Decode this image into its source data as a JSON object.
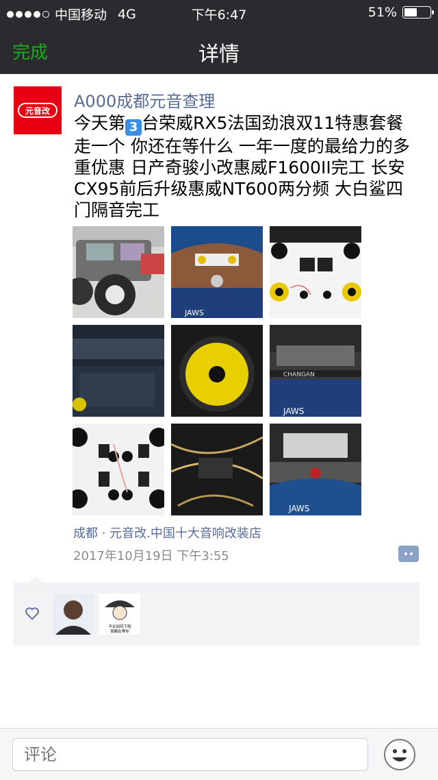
{
  "status_bar": {
    "carrier": "中国移动",
    "network": "4G",
    "time": "下午6:47",
    "battery": "51%",
    "battery_level": 0.51
  },
  "nav": {
    "done_label": "完成",
    "title": "详情"
  },
  "post": {
    "avatar_text": "元音改",
    "username": "A000成都元音查理",
    "text_before_badge": "今天第",
    "badge": "3",
    "text_after_badge": "台荣威RX5法国劲浪双11特惠套餐走一个 你还在等什么 一年一度的最给力的多重优惠 日产奇骏小改惠威F1600II完工 长安CX95前后升级惠威NT600两分频 大白鲨四门隔音完工",
    "images": [
      {
        "name": "photo-jeep"
      },
      {
        "name": "photo-nissan-hood"
      },
      {
        "name": "photo-speaker-board"
      },
      {
        "name": "photo-door-soundproofing"
      },
      {
        "name": "photo-yellow-speaker"
      },
      {
        "name": "photo-changan-hood"
      },
      {
        "name": "photo-speaker-kit"
      },
      {
        "name": "photo-wiring"
      },
      {
        "name": "photo-roewe-hood"
      }
    ],
    "location": "成都 · 元音改.中国十大音响改装店",
    "timestamp": "2017年10月19日 下午3:55"
  },
  "likes": {
    "icon": "heart-icon",
    "users": [
      {
        "name": "like-avatar-man"
      },
      {
        "name": "like-avatar-cartoon",
        "caption_1": "不论刮风下雨",
        "caption_2": "我都在等你"
      }
    ]
  },
  "comment_bar": {
    "placeholder": "评论",
    "emoji_icon": "smiley-icon"
  },
  "colors": {
    "accent_green": "#1aad19",
    "link_blue": "#576b95",
    "nav_bg": "#2b2a2f",
    "brand_red": "#e60012"
  }
}
